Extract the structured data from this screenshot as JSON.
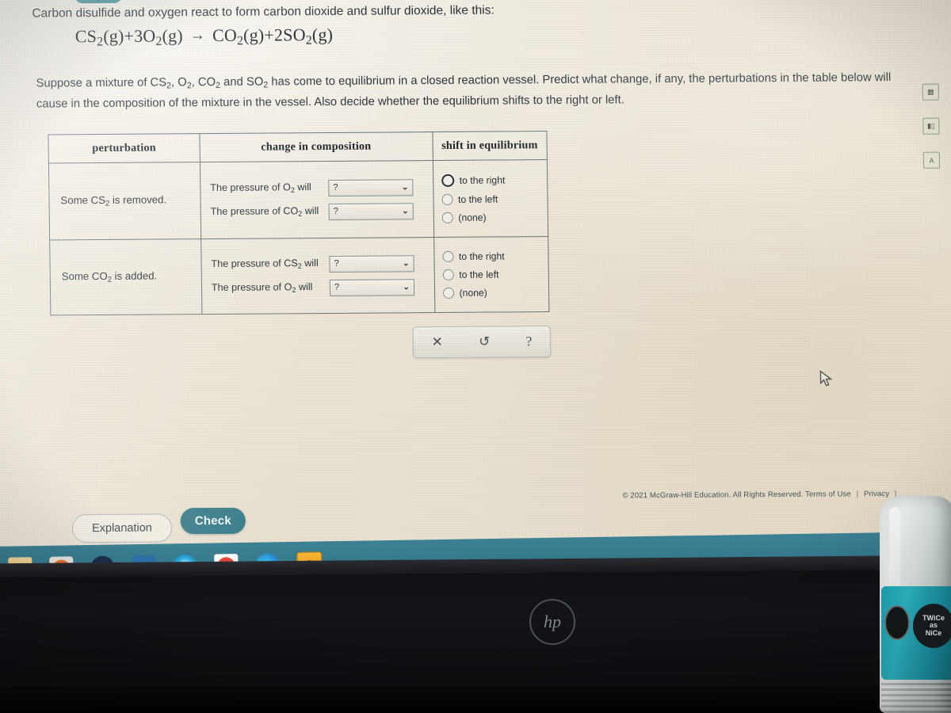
{
  "problem": {
    "intro": "Carbon disulfide and oxygen react to form carbon dioxide and sulfur dioxide, like this:",
    "equation": {
      "reactant_1": "CS",
      "reactant_1_sub": "2",
      "reactant_1_state": "(g)",
      "plus_1": "+",
      "coeff_2": "3",
      "reactant_2": "O",
      "reactant_2_sub": "2",
      "reactant_2_state": "(g)",
      "arrow": "→",
      "product_1": "CO",
      "product_1_sub": "2",
      "product_1_state": "(g)",
      "plus_2": "+",
      "coeff_3": "2",
      "product_2": "SO",
      "product_2_sub": "2",
      "product_2_state": "(g)",
      "plain": "CS2(g)+3O2(g) → CO2(g)+2SO2(g)"
    },
    "body_part_1": "Suppose a mixture of CS",
    "body_full": "Suppose a mixture of CS2, O2, CO2 and SO2 has come to equilibrium in a closed reaction vessel. Predict what change, if any, the perturbations in the table below will cause in the composition of the mixture in the vessel. Also decide whether the equilibrium shifts to the right or left."
  },
  "table": {
    "headers": [
      "perturbation",
      "change in composition",
      "shift in equilibrium"
    ],
    "rows": [
      {
        "perturbation": "Some CS2 is removed.",
        "perturbation_prefix": "Some CS",
        "perturbation_sub": "2",
        "perturbation_suffix": " is removed.",
        "composition": [
          {
            "label_prefix": "The pressure of O",
            "label_sub": "2",
            "label_suffix": " will",
            "dropdown_value": "?",
            "chevron": "⌄"
          },
          {
            "label_prefix": "The pressure of CO",
            "label_sub": "2",
            "label_suffix": " will",
            "dropdown_value": "?",
            "chevron": "⌄"
          }
        ],
        "shift_options": [
          {
            "label": "to the right",
            "selected": false,
            "focused": true
          },
          {
            "label": "to the left",
            "selected": false,
            "focused": false
          },
          {
            "label": "(none)",
            "selected": false,
            "focused": false
          }
        ]
      },
      {
        "perturbation": "Some CO2 is added.",
        "perturbation_prefix": "Some CO",
        "perturbation_sub": "2",
        "perturbation_suffix": " is added.",
        "composition": [
          {
            "label_prefix": "The pressure of CS",
            "label_sub": "2",
            "label_suffix": " will",
            "dropdown_value": "?",
            "chevron": "⌄"
          },
          {
            "label_prefix": "The pressure of O",
            "label_sub": "2",
            "label_suffix": " will",
            "dropdown_value": "?",
            "chevron": "⌄"
          }
        ],
        "shift_options": [
          {
            "label": "to the right",
            "selected": false,
            "focused": false
          },
          {
            "label": "to the left",
            "selected": false,
            "focused": false
          },
          {
            "label": "(none)",
            "selected": false,
            "focused": false
          }
        ]
      }
    ]
  },
  "mini_toolbar": {
    "clear": "✕",
    "undo": "↺",
    "help": "?"
  },
  "buttons": {
    "explanation": "Explanation",
    "check": "Check"
  },
  "footer": {
    "copyright": "© 2021 McGraw-Hill Education. All Rights Reserved.",
    "terms": "Terms of Use",
    "privacy": "Privacy",
    "sep": "|"
  },
  "tool_rail": [
    {
      "name": "calculator",
      "glyph": "▦"
    },
    {
      "name": "bar-chart",
      "glyph": "▮▯"
    },
    {
      "name": "periodic-table",
      "glyph": "A"
    }
  ],
  "taskbar": {
    "items": [
      {
        "name": "file-explorer",
        "glyph": "🗀"
      },
      {
        "name": "media-player",
        "glyph": "▶"
      },
      {
        "name": "hp-support",
        "glyph": "hp"
      },
      {
        "name": "checkmark-app",
        "glyph": "✔"
      },
      {
        "name": "cortana",
        "glyph": ""
      },
      {
        "name": "google-chrome",
        "glyph": ""
      },
      {
        "name": "microsoft-edge",
        "glyph": ""
      },
      {
        "name": "web-shield",
        "glyph": "✛"
      }
    ]
  },
  "desk": {
    "laptop_brand": "hp",
    "bottle_label_line1": "TWiCe",
    "bottle_label_line2": "as",
    "bottle_label_line3": "NiCe"
  },
  "colors": {
    "accent_teal": "#3c7f8c",
    "taskbar": "#34788c",
    "page_bg": "#eee7d9",
    "text": "#2c3136"
  }
}
